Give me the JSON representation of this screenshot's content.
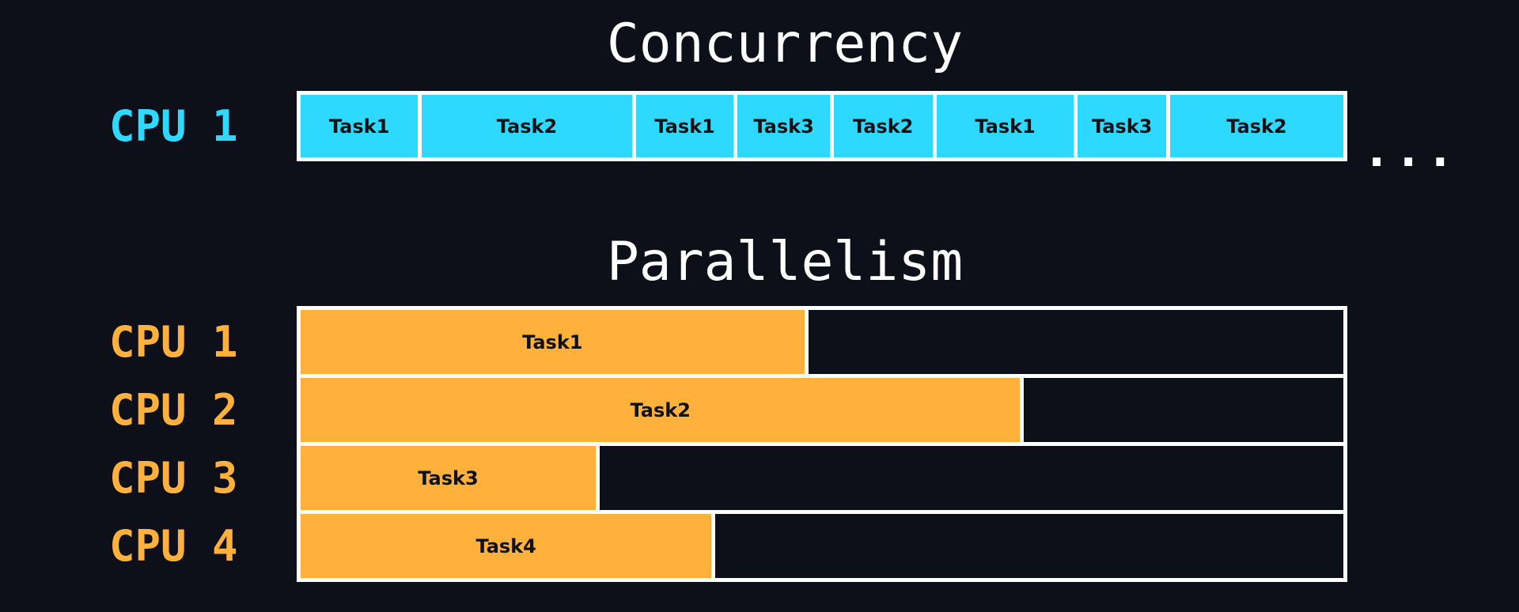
{
  "colors": {
    "background": "#0d1019",
    "concurrency": "#2ed9ff",
    "parallelism": "#ffb13b",
    "border": "#ffffff",
    "idle": "#0d1019"
  },
  "concurrency": {
    "title": "Concurrency",
    "cpu_label": "CPU 1",
    "continuation": "...",
    "segments": [
      {
        "label": "Task1",
        "duration": 121
      },
      {
        "label": "Task2",
        "duration": 217
      },
      {
        "label": "Task1",
        "duration": 101
      },
      {
        "label": "Task3",
        "duration": 95
      },
      {
        "label": "Task2",
        "duration": 102
      },
      {
        "label": "Task1",
        "duration": 142
      },
      {
        "label": "Task3",
        "duration": 91
      },
      {
        "label": "Task2",
        "duration": 179
      }
    ]
  },
  "parallelism": {
    "title": "Parallelism",
    "rows": [
      {
        "cpu_label": "CPU 1",
        "task": "Task1",
        "fraction": 0.483
      },
      {
        "cpu_label": "CPU 2",
        "task": "Task2",
        "fraction": 0.69
      },
      {
        "cpu_label": "CPU 3",
        "task": "Task3",
        "fraction": 0.283
      },
      {
        "cpu_label": "CPU 4",
        "task": "Task4",
        "fraction": 0.394
      }
    ]
  }
}
